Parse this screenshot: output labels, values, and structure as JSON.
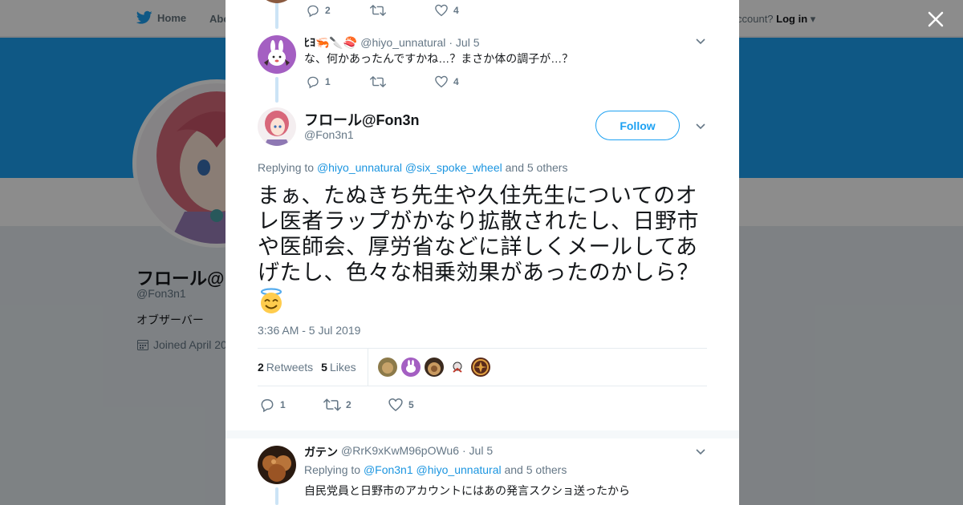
{
  "background": {
    "nav": {
      "home": "Home",
      "about": "Abo",
      "account_prompt": "ccount?",
      "login": "Log in"
    },
    "profile": {
      "name": "フロール@F",
      "handle": "@Fon3n1",
      "bio": "オブザーバー",
      "joined": "Joined April 20"
    }
  },
  "colors": {
    "accent": "#1da1f2",
    "banner": "#1da1f2",
    "thread_line": "#cce4f6"
  },
  "thread": {
    "top_actions": {
      "replies": "2",
      "retweets": "",
      "likes": "4"
    },
    "reply1": {
      "name": "ﾋﾖ🦐🔪🍣",
      "handle": "@hiyo_unnatural",
      "date": "· Jul 5",
      "text": "な、何かあったんですかね…？まさか体の調子が…？",
      "replies": "1",
      "retweets": "",
      "likes": "4"
    }
  },
  "main_tweet": {
    "name": "フロール@Fon3n",
    "handle": "@Fon3n1",
    "follow_label": "Follow",
    "replying_prefix": "Replying to",
    "mention1": "@hiyo_unnatural",
    "mention2": "@six_spoke_wheel",
    "others": "and 5 others",
    "text": "まぁ、たぬきち先生や久住先生についてのオレ医者ラップがかなり拡散されたし、日野市や医師会、厚労省などに詳しくメールしてあげたし、色々な相乗効果があったのかしら？",
    "emoji": "smiling-face-with-halo",
    "timestamp": "3:36 AM - 5 Jul 2019",
    "retweets_count": "2",
    "retweets_label": "Retweets",
    "likes_count": "5",
    "likes_label": "Likes",
    "reply_count": "1",
    "retweet_count": "2",
    "like_count": "5"
  },
  "reply2": {
    "name": "ガテン",
    "handle": "@RrK9xKwM96pOWu6",
    "date": "· Jul 5",
    "replying_prefix": "Replying to",
    "mention1": "@Fon3n1",
    "mention2": "@hiyo_unnatural",
    "others": "and 5 others",
    "text": "自民党員と日野市のアカウントにはあの発言スクショ送ったから"
  }
}
